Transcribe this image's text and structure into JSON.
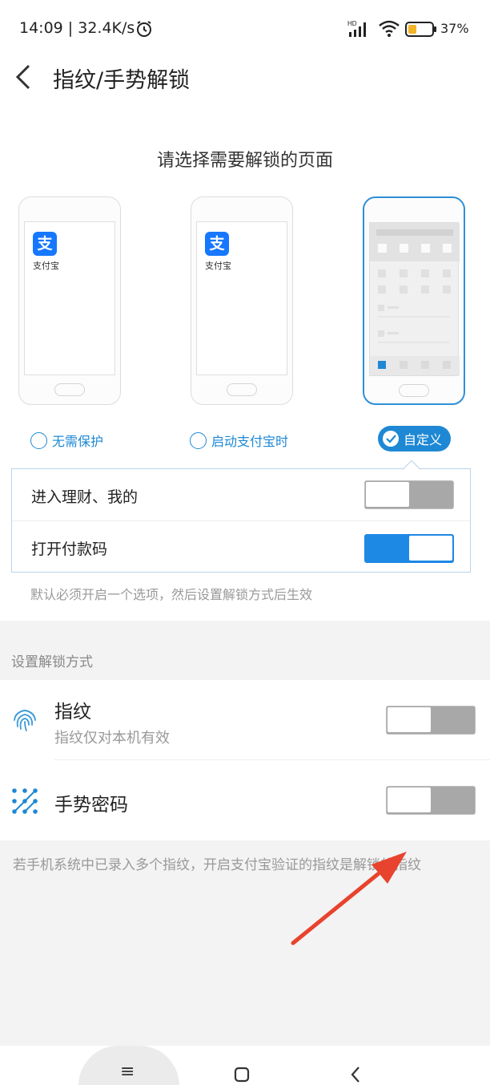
{
  "status_bar": {
    "time": "14:09 | 32.4K/s",
    "battery_pct": "37%",
    "battery_level": 0.37
  },
  "header": {
    "title": "指纹/手势解锁"
  },
  "section": {
    "title": "请选择需要解锁的页面"
  },
  "phones": [
    {
      "app_label": "支付宝",
      "app_glyph": "支",
      "selected": false
    },
    {
      "app_label": "支付宝",
      "app_glyph": "支",
      "selected": false
    },
    {
      "selected": true
    }
  ],
  "options": [
    {
      "label": "无需保护",
      "selected": false
    },
    {
      "label": "启动支付宝时",
      "selected": false
    },
    {
      "label": "自定义",
      "selected": true
    }
  ],
  "custom": {
    "rows": [
      {
        "label": "进入理财、我的",
        "on": false
      },
      {
        "label": "打开付款码",
        "on": true
      }
    ],
    "hint": "默认必须开启一个选项，然后设置解锁方式后生效"
  },
  "unlock": {
    "section_label": "设置解锁方式",
    "items": [
      {
        "title": "指纹",
        "subtitle": "指纹仅对本机有效",
        "icon": "fingerprint-icon",
        "on": false
      },
      {
        "title": "手势密码",
        "icon": "gesture-icon",
        "on": false
      }
    ],
    "footnote": "若手机系统中已录入多个指纹，开启支付宝验证的指纹是解锁的指纹"
  },
  "nav": {
    "menu_icon": "≡"
  },
  "colors": {
    "accent": "#1e88d4",
    "toggle_on": "#1e88e5",
    "toggle_off": "#a8a8a8",
    "annotation_arrow": "#e8432e"
  }
}
